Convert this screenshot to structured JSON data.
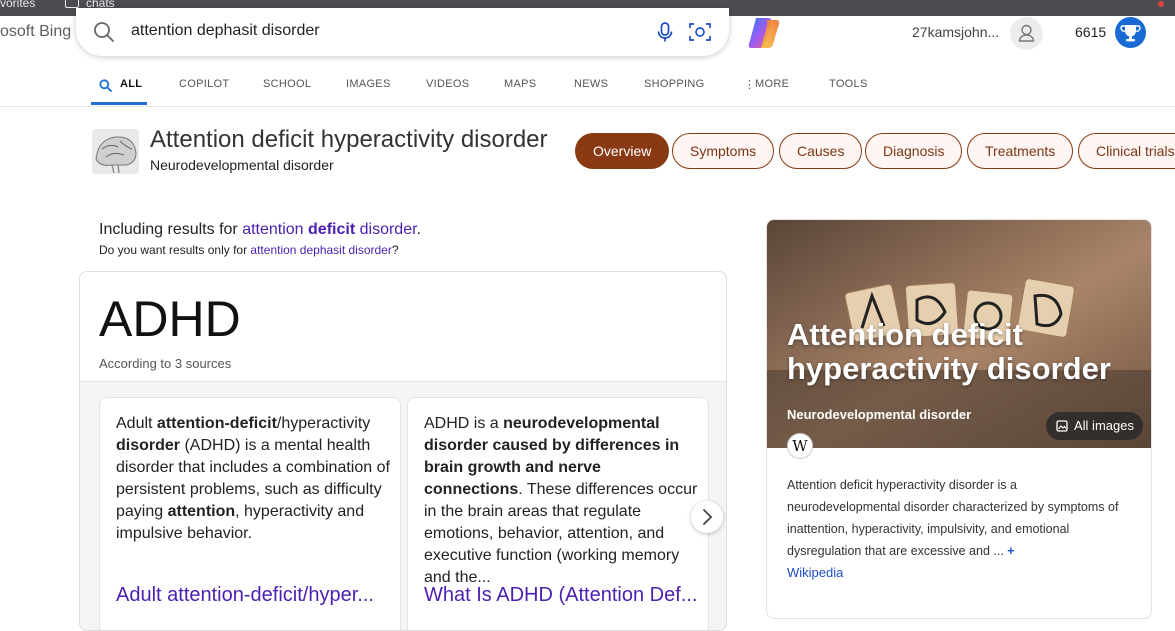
{
  "browser": {
    "favorites_label": "vorites",
    "chats_label": "chats"
  },
  "header": {
    "brand": "osoft Bing",
    "query": "attention dephasit disorder",
    "username": "27kamsjohn...",
    "points": "6615"
  },
  "tabs": [
    {
      "label": "ALL",
      "active": true
    },
    {
      "label": "COPILOT"
    },
    {
      "label": "SCHOOL"
    },
    {
      "label": "IMAGES"
    },
    {
      "label": "VIDEOS"
    },
    {
      "label": "MAPS"
    },
    {
      "label": "NEWS"
    },
    {
      "label": "SHOPPING"
    },
    {
      "label": "MORE"
    },
    {
      "label": "TOOLS"
    }
  ],
  "entity": {
    "title": "Attention deficit hyperactivity disorder",
    "subtitle": "Neurodevelopmental disorder",
    "pills": [
      "Overview",
      "Symptoms",
      "Causes",
      "Diagnosis",
      "Treatments",
      "Clinical trials"
    ]
  },
  "including": {
    "prefix": "Including results for",
    "word1": "attention",
    "word2": "deficit",
    "word3": "disorder",
    "dot": ".",
    "dym_prefix": "Do you want results only for",
    "dym_link": "attention dephasit disorder",
    "dym_suffix": "?"
  },
  "answer": {
    "title": "ADHD",
    "sources": "According to 3 sources",
    "snippets": [
      {
        "t1": "Adult ",
        "b1": "attention-deficit",
        "t2": "/hyperactivity ",
        "b2": "disorder",
        "t3": " (ADHD) is a mental health disorder that includes a combination of persistent problems, such as difficulty paying ",
        "b3": "attention",
        "t4": ", hyperactivity and impulsive behavior.",
        "link": "Adult attention-deficit/hyper..."
      },
      {
        "t1": "ADHD is a ",
        "b1": "neurodevelopmental disorder caused by differences in brain growth and nerve connections",
        "t2": ". These differences occur in the brain areas that regulate emotions, behavior, attention, and executive function (working memory and the...",
        "link": "What Is ADHD (Attention Def..."
      }
    ]
  },
  "side": {
    "title": "Attention deficit hyperactivity disorder",
    "subtitle": "Neurodevelopmental disorder",
    "all_images": "All images",
    "wiki_letter": "W",
    "description": "Attention deficit hyperactivity disorder is a neurodevelopmental disorder characterized by symptoms of inattention, hyperactivity, impulsivity, and emotional dysregulation that are excessive and ...",
    "more": "+",
    "source": "Wikipedia"
  },
  "colors": {
    "accent_brown": "#8a3a13",
    "link_purple": "#4b1fb0",
    "tab_blue": "#1f6fd6"
  }
}
